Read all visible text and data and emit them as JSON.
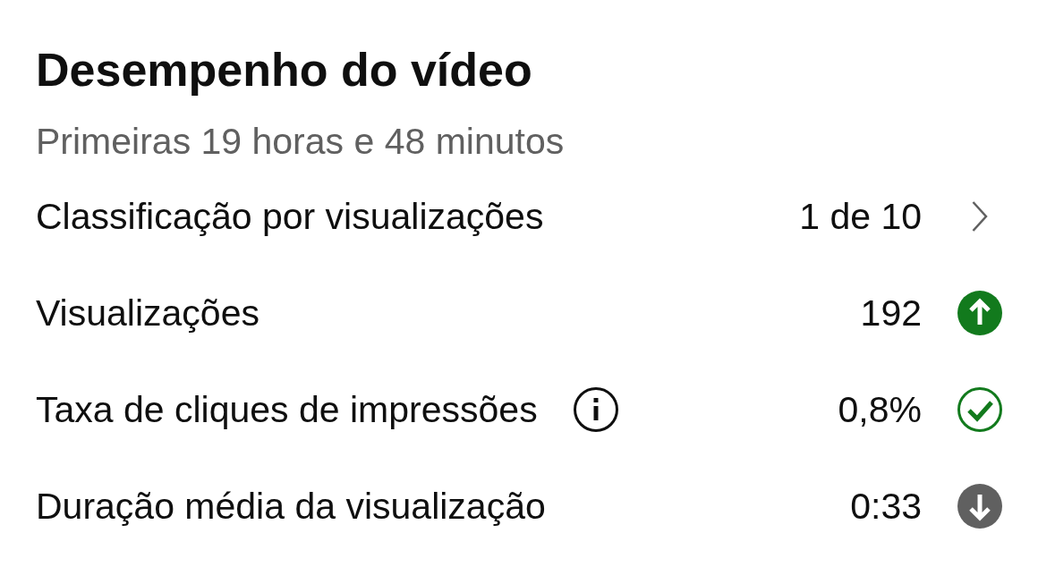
{
  "title": "Desempenho do vídeo",
  "subtitle": "Primeiras 19 horas e 48 minutos",
  "metrics": [
    {
      "label": "Classificação por visualizações",
      "info": false,
      "value": "1 de 10",
      "kind": "chevron"
    },
    {
      "label": "Visualizações",
      "info": false,
      "value": "192",
      "kind": "up"
    },
    {
      "label": "Taxa de cliques de impressões",
      "info": true,
      "value": "0,8%",
      "kind": "check"
    },
    {
      "label": "Duração média da visualização",
      "info": false,
      "value": "0:33",
      "kind": "down"
    }
  ]
}
